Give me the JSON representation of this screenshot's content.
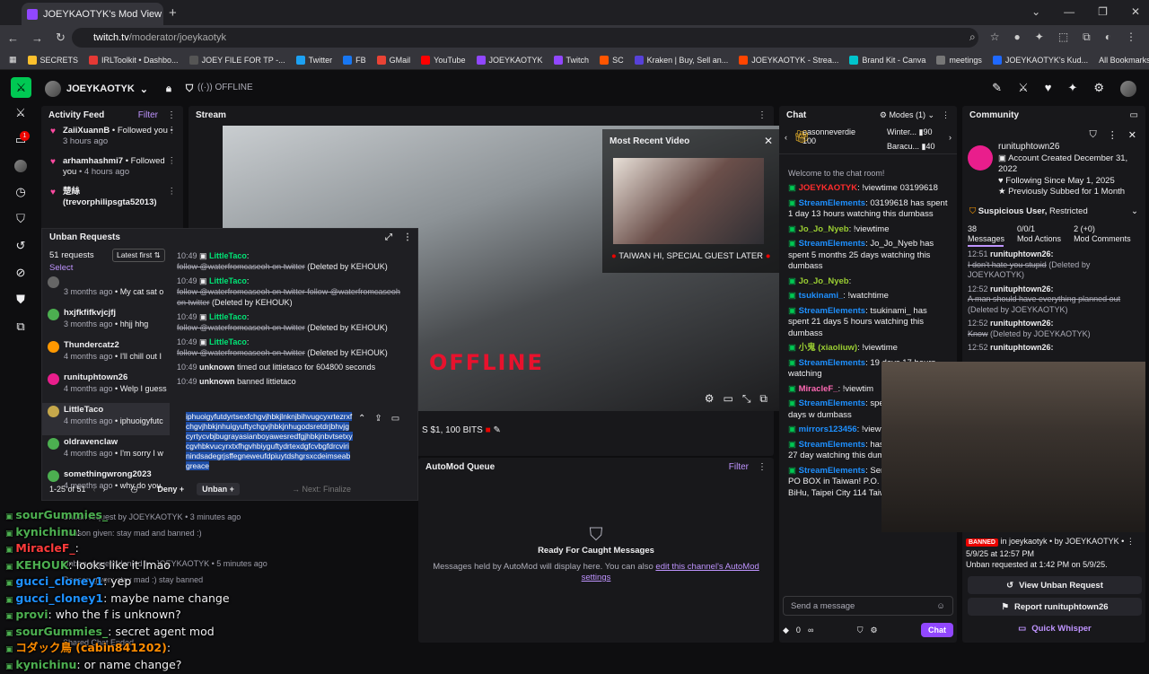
{
  "browser": {
    "tab_title": "JOEYKAOTYK's Mod View - Twitch",
    "url_host": "twitch.tv",
    "url_path": "/moderator/joeykaotyk",
    "bookmarks": [
      "SECRETS",
      "IRLToolkit • Dashbo...",
      "JOEY FILE FOR TP -...",
      "Twitter",
      "FB",
      "GMail",
      "YouTube",
      "JOEYKAOTYK",
      "Twitch",
      "SC",
      "Kraken | Buy, Sell an...",
      "JOEYKAOTYK - Strea...",
      "Brand Kit - Canva",
      "meetings",
      "JOEYKAOTYK's Kud..."
    ],
    "all_bookmarks": "All Bookmarks"
  },
  "topnav": {
    "channel": "JOEYKAOTYK",
    "status": "OFFLINE"
  },
  "activity": {
    "title": "Activity Feed",
    "filter": "Filter",
    "items": [
      {
        "user": "ZaiiXuannB",
        "action": "• Followed you",
        "time": "• 3 hours ago"
      },
      {
        "user": "arhamhashmi7",
        "action": "• Followed you",
        "time": "• 4 hours ago"
      },
      {
        "user": "楚絲 (trevorphilipsgta52013)",
        "action": "",
        "time": ""
      }
    ]
  },
  "unban": {
    "title": "Unban Requests",
    "count": "51 requests",
    "sort": "Latest first",
    "select": "Select",
    "list": [
      {
        "user": "",
        "time": "3 months ago",
        "msg": "My cat sat o"
      },
      {
        "user": "hxjfkfifkvjcjfj",
        "time": "3 months ago",
        "msg": "hhjj hhg"
      },
      {
        "user": "Thundercatz2",
        "time": "4 months ago",
        "msg": "I'll chill out I"
      },
      {
        "user": "runituphtown26",
        "time": "4 months ago",
        "msg": "Welp I guess"
      },
      {
        "user": "LittleTaco",
        "time": "4 months ago",
        "msg": "iphuoigyfutc"
      },
      {
        "user": "oldravenclaw",
        "time": "4 months ago",
        "msg": "I'm sorry I w"
      },
      {
        "user": "somethingwrong2023",
        "time": "4 months ago",
        "msg": "why do you"
      }
    ],
    "pagination": "1-25 of 51",
    "log": [
      {
        "time": "10:49",
        "user": "LittleTaco",
        "msg": "follow @waterfromcaseoh on twitter",
        "note": "(Deleted by KEHOUK)"
      },
      {
        "time": "10:49",
        "user": "LittleTaco",
        "msg": "follow @waterfromcaseoh on twitter follow @waterfromcaseoh on twitter",
        "note": "(Deleted by KEHOUK)"
      },
      {
        "time": "10:49",
        "user": "LittleTaco",
        "msg": "follow @waterfromcaseoh on twitter",
        "note": "(Deleted by KEHOUK)"
      },
      {
        "time": "10:49",
        "user": "LittleTaco",
        "msg": "follow @waterfromcaseoh on twitter",
        "note": "(Deleted by KEHOUK)"
      }
    ],
    "event1": {
      "time": "10:49",
      "who": "unknown",
      "text": "timed out littietaco for 604800 seconds"
    },
    "event2": {
      "time": "10:49",
      "who": "unknown",
      "text": "banned littietaco"
    },
    "reply": "iphuoigyfutdyrtsexfchgvjhbkjlnknjbihvugcyxrtezrxfchgvjhbkjnhuigyuftychgvjhbkjnhugodsretdrjbhvjgcyrtycvbjbugrayasianboyawesredfgjhbkjnbvtsetxycgvhbkvucyrxtxfhgvhbiyguftydrtexdgfcvbgfdrcvirinindsadegrjsffegneweufdpiuytdshgrsxcdeimseabgreace",
    "deny": "Deny",
    "unban_btn": "Unban",
    "next": "Next: Finalize"
  },
  "stream": {
    "title": "Stream",
    "offline_text": "OFFLINE",
    "recent_title": "Most Recent Video",
    "recent_caption": "TAIWAN HI, SPECIAL GUEST LATER",
    "bits": "S $1, 100 BITS"
  },
  "automod": {
    "title": "AutoMod Queue",
    "filter": "Filter",
    "empty_title": "Ready For Caught Messages",
    "empty_body": "Messages held by AutoMod will display here. You can also",
    "empty_link": "edit this channel's AutoMod settings"
  },
  "chat": {
    "title": "Chat",
    "modes": "Modes (1)",
    "leaderboard": [
      {
        "name": "easonneverdie",
        "value": "100"
      },
      {
        "name": "Winter...",
        "value": "90"
      },
      {
        "name": "Baracu...",
        "value": "40"
      }
    ],
    "welcome": "Welcome to the chat room!",
    "messages": [
      {
        "user": "JOEYKAOTYK",
        "cls": "rd",
        "text": ": !viewtime 03199618"
      },
      {
        "user": "StreamElements",
        "cls": "se",
        "text": ": 03199618 has spent 1 day 13 hours watching this dumbass"
      },
      {
        "user": "Jo_Jo_Nyeb",
        "cls": "jo",
        "text": ": !viewtime"
      },
      {
        "user": "StreamElements",
        "cls": "se",
        "text": ": Jo_Jo_Nyeb has spent 5 months 25 days watching this dumbass"
      },
      {
        "user": "Jo_Jo_Nyeb",
        "cls": "jo",
        "text": ":"
      },
      {
        "user": "tsukinami_",
        "cls": "se",
        "text": ": !watchtime"
      },
      {
        "user": "StreamElements",
        "cls": "se",
        "text": ": tsukinami_ has spent 21 days 5 hours watching this dumbass"
      },
      {
        "user": "小鬼 (xiaoliuw)",
        "cls": "jo",
        "text": ": !viewtime"
      },
      {
        "user": "StreamElements",
        "cls": "se",
        "text": ": 19 days 17 hours watching"
      },
      {
        "user": "MiracleF_",
        "cls": "mi",
        "text": ": !viewtim"
      },
      {
        "user": "StreamElements",
        "cls": "se",
        "text": ": spent 3 months 22 days w dumbass"
      },
      {
        "user": "mirrors123456",
        "cls": "se",
        "text": ": !viewti"
      },
      {
        "user": "StreamElements",
        "cls": "se",
        "text": ": has spent 1 month 27 day watching this dumbass"
      },
      {
        "user": "StreamElements",
        "cls": "se",
        "text": ": Send me stuff in my PO BOX in Taiwan! P.O. Box 69 NeiHu, BiHu, Taipei City 114 Taiwan (R.O.C.)"
      }
    ],
    "placeholder": "Send a message",
    "points": "0",
    "chat_btn": "Chat"
  },
  "community": {
    "title": "Community",
    "user": "runituphtown26",
    "created": "Account Created December 31, 2022",
    "following": "Following Since May 1, 2025",
    "subbed": "Previously Subbed for 1 Month",
    "suspicious": "Suspicious User,",
    "restricted": "Restricted",
    "stats": [
      {
        "num": "38",
        "label": "Messages"
      },
      {
        "num": "0/0/1",
        "label": "Mod Actions"
      },
      {
        "num": "2 (+0)",
        "label": "Mod Comments"
      }
    ],
    "log": [
      {
        "time": "12:51",
        "user": "runituphtown26:",
        "msg": "I don't hate you stupid",
        "note": "(Deleted by JOEYKAOTYK)"
      },
      {
        "time": "12:52",
        "user": "runituphtown26:",
        "msg": "A man should have everything planned out",
        "note": "(Deleted by JOEYKAOTYK)"
      },
      {
        "time": "12:52",
        "user": "runituphtown26:",
        "msg": "Know",
        "note": "(Deleted by JOEYKAOTYK)"
      },
      {
        "time": "12:52",
        "user": "runituphtown26:",
        "msg": "",
        "note": ""
      }
    ],
    "ban_badge": "BANNED",
    "ban_line": "in joeykaotyk • by JOEYKAOTYK •",
    "ban_time": "5/9/25 at 12:57 PM",
    "unban_req": "Unban requested at 1:42 PM on 5/9/25.",
    "view_btn": "View Unban Request",
    "report_btn": "Report runituphtown26",
    "whisper_btn": "Quick Whisper"
  },
  "overlay": {
    "lines": [
      {
        "name": "sourGummies_",
        "color": "#4caf50",
        "text": ""
      },
      {
        "name": "kynichinu",
        "color": "#4caf50",
        "text": ":"
      },
      {
        "name": "MiracleF_",
        "color": "#ff3b3b",
        "text": ":"
      },
      {
        "name": "KEHOUK",
        "color": "#4caf50",
        "text": ": looks like it lmao"
      },
      {
        "name": "gucci_cloney1",
        "color": "#1e90ff",
        "text": ": yep"
      },
      {
        "name": "gucci_cloney1",
        "color": "#1e90ff",
        "text": ": maybe name change"
      },
      {
        "name": "provi",
        "color": "#4caf50",
        "text": ": who the f is unknown?"
      },
      {
        "name": "sourGummies_",
        "color": "#4caf50",
        "text": ": secret agent mod"
      },
      {
        "name": "コダック鳥 (cabin841202)",
        "color": "#ff8c00",
        "text": ":"
      },
      {
        "name": "kynichinu",
        "color": "#4caf50",
        "text": ": or name change?"
      }
    ],
    "behind": [
      {
        "text": "Unban request by JOEYKAOTYK • 3 minutes ago"
      },
      {
        "text": "Reason given: stay mad and banned :)"
      },
      {
        "text": "Unban request denied by JOEYKAOTYK • 5 minutes ago"
      },
      {
        "text": "Reason given: stay mad :) stay banned"
      },
      {
        "text": "Shared Chat Ended"
      }
    ]
  }
}
